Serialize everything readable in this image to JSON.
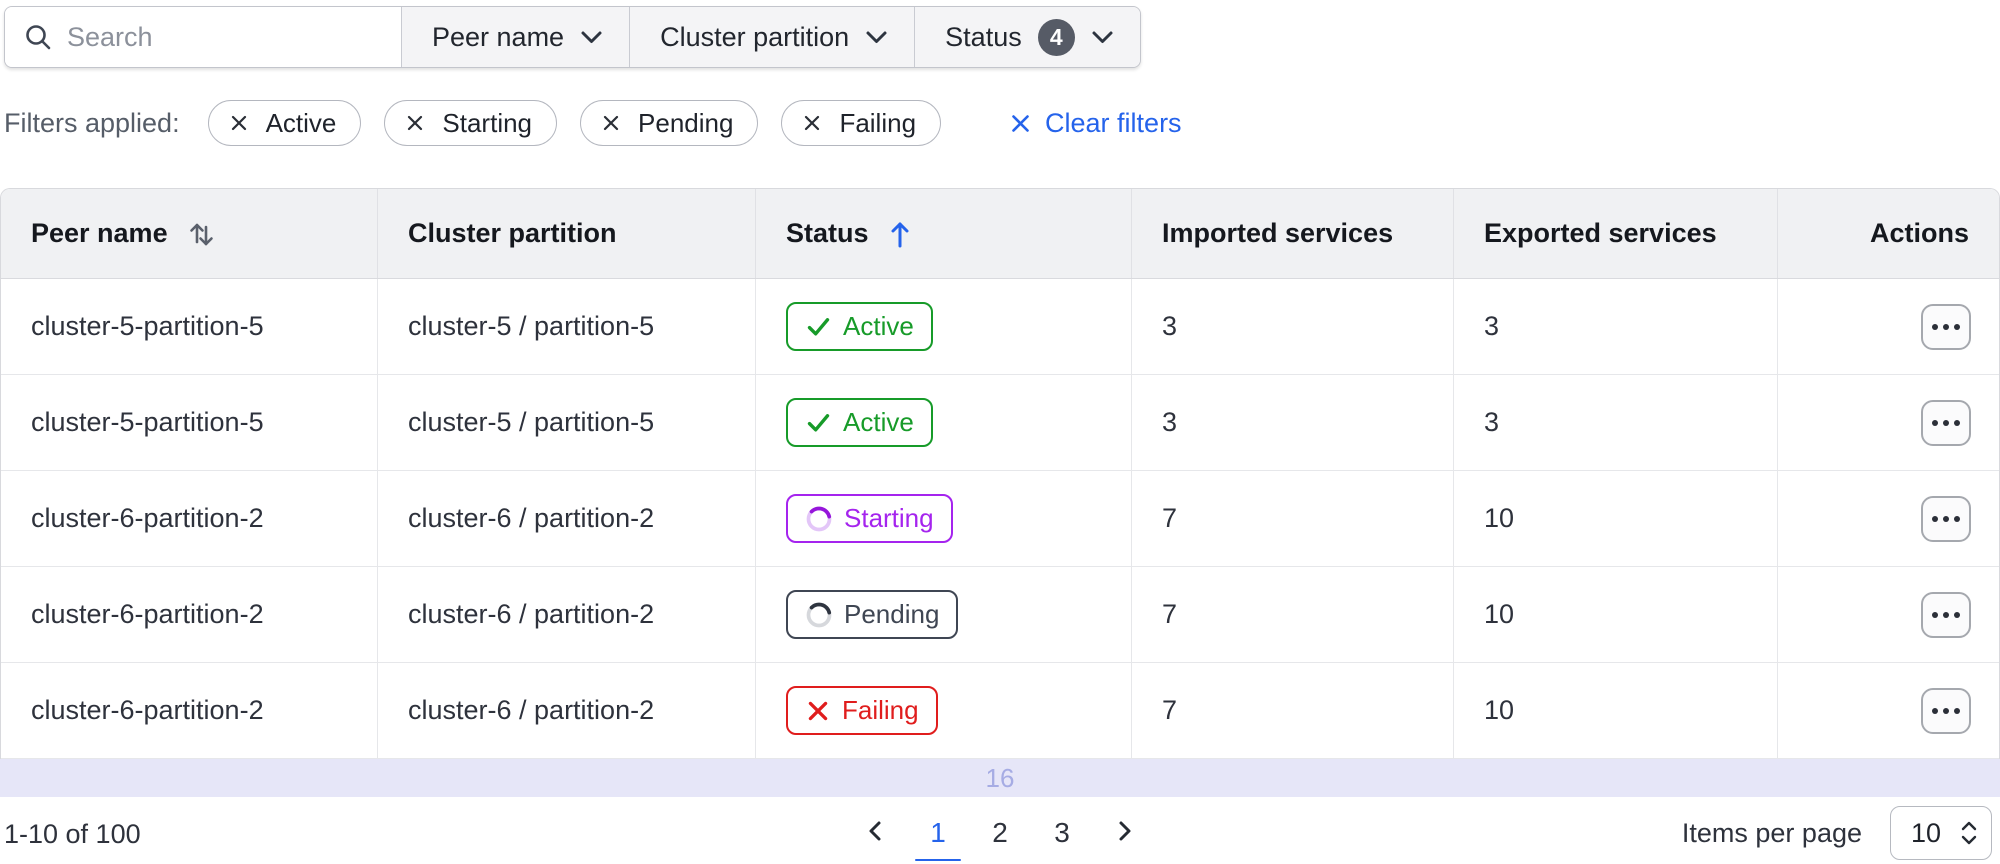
{
  "filter_bar": {
    "search": {
      "placeholder": "Search",
      "value": "",
      "icon": "search-icon"
    },
    "dropdowns": [
      {
        "label": "Peer name",
        "icon": "chevron-down-icon"
      },
      {
        "label": "Cluster partition",
        "icon": "chevron-down-icon"
      },
      {
        "label": "Status",
        "badge_count": "4",
        "icon": "chevron-down-icon"
      }
    ]
  },
  "filters_applied": {
    "label": "Filters applied:",
    "chips": [
      {
        "label": "Active",
        "remove_icon": "x-icon"
      },
      {
        "label": "Starting",
        "remove_icon": "x-icon"
      },
      {
        "label": "Pending",
        "remove_icon": "x-icon"
      },
      {
        "label": "Failing",
        "remove_icon": "x-icon"
      }
    ],
    "clear_label": "Clear filters",
    "clear_color": "#2563eb"
  },
  "table": {
    "columns": [
      {
        "label": "Peer name",
        "sort": "both",
        "sort_icon": "sort-arrows-icon"
      },
      {
        "label": "Cluster partition",
        "sort": "none"
      },
      {
        "label": "Status",
        "sort": "asc",
        "sort_icon": "arrow-up-icon"
      },
      {
        "label": "Imported services",
        "sort": "none"
      },
      {
        "label": "Exported services",
        "sort": "none"
      },
      {
        "label": "Actions",
        "sort": "none"
      }
    ],
    "rows": [
      {
        "peer": "cluster-5-partition-5",
        "partition": "cluster-5 / partition-5",
        "status": "Active",
        "imported": "3",
        "exported": "3"
      },
      {
        "peer": "cluster-5-partition-5",
        "partition": "cluster-5 / partition-5",
        "status": "Active",
        "imported": "3",
        "exported": "3"
      },
      {
        "peer": "cluster-6-partition-2",
        "partition": "cluster-6 / partition-2",
        "status": "Starting",
        "imported": "7",
        "exported": "10"
      },
      {
        "peer": "cluster-6-partition-2",
        "partition": "cluster-6 / partition-2",
        "status": "Pending",
        "imported": "7",
        "exported": "10"
      },
      {
        "peer": "cluster-6-partition-2",
        "partition": "cluster-6 / partition-2",
        "status": "Failing",
        "imported": "7",
        "exported": "10"
      }
    ],
    "status_colors": {
      "Active": "#179b29",
      "Starting": "#a524ee",
      "Pending": "#3f4653",
      "Failing": "#e01d1d"
    },
    "status_icons": {
      "Active": "check-icon",
      "Starting": "spinner-icon",
      "Pending": "spinner-icon",
      "Failing": "x-icon"
    },
    "actions_button_icon": "ellipsis-icon",
    "partial_row_indicator": "16"
  },
  "pagination": {
    "range_text": "1-10 of 100",
    "pages": [
      "1",
      "2",
      "3"
    ],
    "current_page": "1",
    "prev_icon": "chevron-left-icon",
    "next_icon": "chevron-right-icon",
    "items_per_page_label": "Items per page",
    "items_per_page_value": "10",
    "accent_color": "#2563eb"
  }
}
